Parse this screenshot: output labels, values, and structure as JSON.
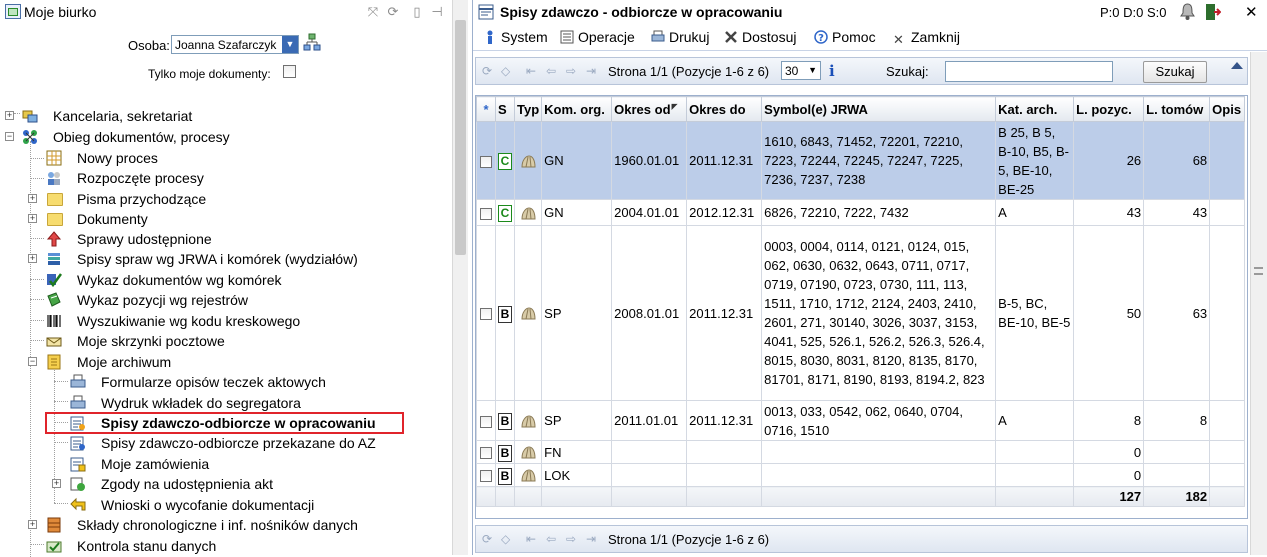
{
  "left": {
    "title": "Moje biurko",
    "osoba_label": "Osoba:",
    "osoba_value": "Joanna Szafarczyk",
    "tylko_label": "Tylko moje dokumenty:",
    "tree": [
      {
        "label": "Kancelaria, sekretariat",
        "icon": "chairs-icon"
      },
      {
        "label": "Obieg dokumentów, procesy",
        "icon": "process-icon"
      },
      {
        "label": "Nowy proces",
        "icon": "grid-icon"
      },
      {
        "label": "Rozpoczęte procesy",
        "icon": "users-icon"
      },
      {
        "label": "Pisma przychodzące",
        "icon": "folder-icon"
      },
      {
        "label": "Dokumenty",
        "icon": "folder-icon"
      },
      {
        "label": "Sprawy udostępnione",
        "icon": "share-icon"
      },
      {
        "label": "Spisy spraw wg JRWA i komórek (wydziałów)",
        "icon": "books-icon"
      },
      {
        "label": "Wykaz dokumentów wg komórek",
        "icon": "checkmark-icon"
      },
      {
        "label": "Wykaz pozycji wg rejestrów",
        "icon": "ledger-icon"
      },
      {
        "label": "Wyszukiwanie wg kodu kreskowego",
        "icon": "barcode-icon"
      },
      {
        "label": "Moje skrzynki pocztowe",
        "icon": "mailbox-icon"
      },
      {
        "label": "Moje archiwum",
        "icon": "archive-icon"
      },
      {
        "label": "Formularze opisów teczek aktowych",
        "icon": "printer-icon"
      },
      {
        "label": "Wydruk wkładek do segregatora",
        "icon": "printer-icon"
      },
      {
        "label": "Spisy zdawczo-odbiorcze w opracowaniu",
        "icon": "list-edit-icon"
      },
      {
        "label": "Spisy zdawczo-odbiorcze przekazane do AZ",
        "icon": "list-sent-icon"
      },
      {
        "label": "Moje zamówienia",
        "icon": "order-icon"
      },
      {
        "label": "Zgody na udostępnienia akt",
        "icon": "approval-icon"
      },
      {
        "label": "Wnioski o wycofanie dokumentacji",
        "icon": "undo-arrow-icon"
      },
      {
        "label": "Składy chronologiczne i inf. nośników danych",
        "icon": "cabinet-icon"
      },
      {
        "label": "Kontrola stanu danych",
        "icon": "check-data-icon"
      }
    ]
  },
  "right": {
    "title": "Spisy zdawczo - odbiorcze w opracowaniu",
    "status": "P:0 D:0 S:0",
    "menu": {
      "system": "System",
      "operacje": "Operacje",
      "drukuj": "Drukuj",
      "dostosuj": "Dostosuj",
      "pomoc": "Pomoc",
      "zamknij": "Zamknij"
    },
    "pager": {
      "text": "Strona 1/1 (Pozycje 1-6 z 6)",
      "page_size": "30",
      "search_label": "Szukaj:",
      "search_value": "",
      "search_button": "Szukaj"
    },
    "columns": {
      "star": "*",
      "s": "S",
      "typ": "Typ",
      "kom": "Kom. org.",
      "od": "Okres od",
      "do": "Okres do",
      "symbol": "Symbol(e) JRWA",
      "kat": "Kat. arch.",
      "lpoz": "L. pozyc.",
      "ltom": "L. tomów",
      "opis": "Opis"
    },
    "rows": [
      {
        "badge": "C",
        "kom": "GN",
        "od": "1960.01.01",
        "do": "2011.12.31",
        "symbol": "1610, 6843, 71452, 72201, 72210, 7223, 72244, 72245, 72247, 7225, 7236, 7237, 7238",
        "kat": "B 25, B 5, B-10, B5, B-5, BE-10, BE-25",
        "lpoz": "26",
        "ltom": "68"
      },
      {
        "badge": "C",
        "kom": "GN",
        "od": "2004.01.01",
        "do": "2012.12.31",
        "symbol": "6826, 72210, 7222, 7432",
        "kat": "A",
        "lpoz": "43",
        "ltom": "43"
      },
      {
        "badge": "B",
        "kom": "SP",
        "od": "2008.01.01",
        "do": "2011.12.31",
        "symbol": "0003, 0004, 0114, 0121, 0124, 015, 062, 0630, 0632, 0643, 0711, 0717, 0719, 07190, 0723, 0730, 111, 113, 1511, 1710, 1712, 2124, 2403, 2410, 2601, 271, 30140, 3026, 3037, 3153, 4041, 525, 526.1, 526.2, 526.3, 526.4, 8015, 8030, 8031, 8120, 8135, 8170, 81701, 8171, 8190, 8193, 8194.2, 823",
        "kat": "B-5, BC, BE-10, BE-5",
        "lpoz": "50",
        "ltom": "63"
      },
      {
        "badge": "B",
        "kom": "SP",
        "od": "2011.01.01",
        "do": "2011.12.31",
        "symbol": "0013, 033, 0542, 062, 0640, 0704, 0716, 1510",
        "kat": "A",
        "lpoz": "8",
        "ltom": "8"
      },
      {
        "badge": "B",
        "kom": "FN",
        "od": "",
        "do": "",
        "symbol": "",
        "kat": "",
        "lpoz": "0",
        "ltom": ""
      },
      {
        "badge": "B",
        "kom": "LOK",
        "od": "",
        "do": "",
        "symbol": "",
        "kat": "",
        "lpoz": "0",
        "ltom": ""
      }
    ],
    "totals": {
      "lpoz": "127",
      "ltom": "182"
    },
    "bottom_pager": {
      "text": "Strona 1/1 (Pozycje 1-6 z 6)"
    }
  }
}
